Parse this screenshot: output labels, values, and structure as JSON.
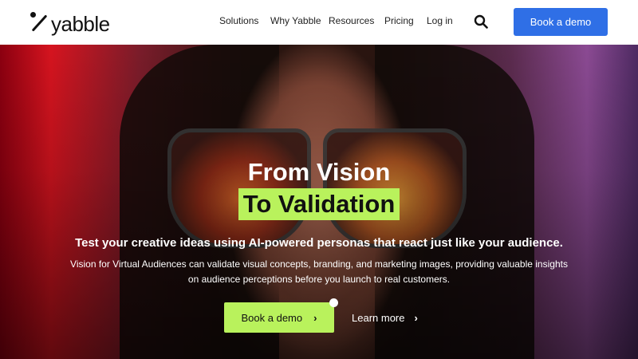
{
  "brand": {
    "name": "yabble"
  },
  "nav": {
    "links": [
      "Solutions",
      "Why Yabble",
      "Resources",
      "Pricing",
      "Log in"
    ],
    "search_icon": "search-icon",
    "cta": "Book a demo",
    "cta_color": "#2f6fe6"
  },
  "hero": {
    "title_line1": "From Vision",
    "title_line2": "To Validation",
    "highlight_color": "#b9f25c",
    "subtitle": "Test your creative ideas using AI-powered personas that react just like your audience.",
    "description": "Vision for Virtual Audiences can validate visual concepts, branding, and marketing images, providing valuable insights on audience perceptions before you launch to real customers.",
    "primary_button": "Book a demo",
    "secondary_button": "Learn more",
    "chevron": "›"
  }
}
